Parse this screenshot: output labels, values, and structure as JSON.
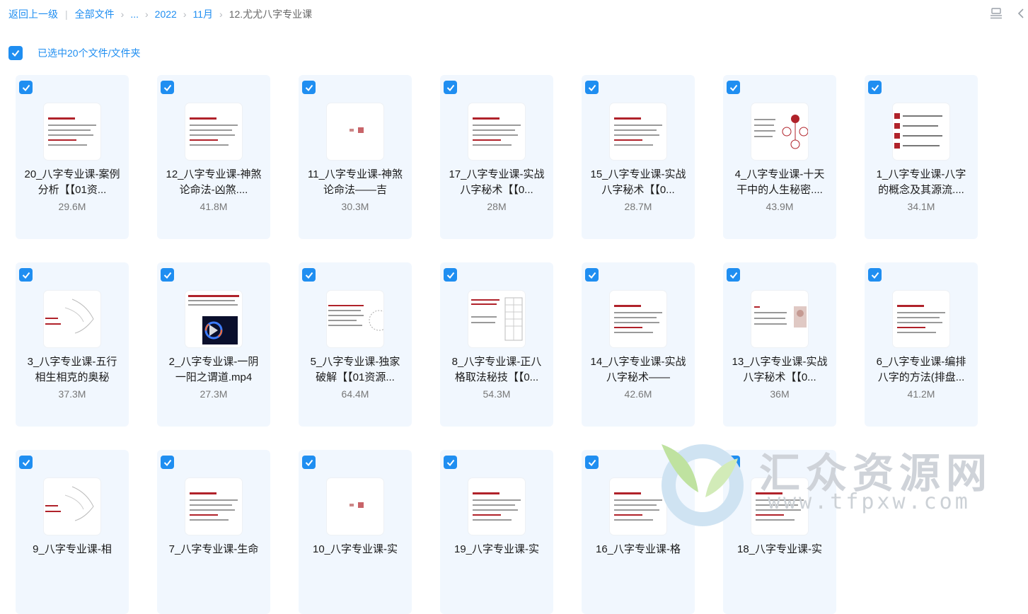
{
  "breadcrumb": {
    "back": "返回上一级",
    "all": "全部文件",
    "ellipsis": "...",
    "year": "2022",
    "month": "11月",
    "current": "12.尤尤八字专业课"
  },
  "selection": {
    "text": "已选中20个文件/文件夹"
  },
  "files": [
    {
      "name": "20_八字专业课-案例分析【【01资...",
      "size": "29.6M",
      "thumb": "text"
    },
    {
      "name": "12_八字专业课-神煞论命法-凶煞....",
      "size": "41.8M",
      "thumb": "text"
    },
    {
      "name": "11_八字专业课-神煞论命法——吉",
      "size": "30.3M",
      "thumb": "tiny"
    },
    {
      "name": "17_八字专业课-实战八字秘术【【0...",
      "size": "28M",
      "thumb": "text"
    },
    {
      "name": "15_八字专业课-实战八字秘术【【0...",
      "size": "28.7M",
      "thumb": "text"
    },
    {
      "name": "4_八字专业课-十天干中的人生秘密....",
      "size": "43.9M",
      "thumb": "diagram"
    },
    {
      "name": "1_八字专业课-八字的概念及其源流....",
      "size": "34.1M",
      "thumb": "list"
    },
    {
      "name": "3_八字专业课-五行相生相克的奥秘",
      "size": "37.3M",
      "thumb": "sketch"
    },
    {
      "name": "2_八字专业课-一阴一阳之谓道.mp4",
      "size": "27.3M",
      "thumb": "video"
    },
    {
      "name": "5_八字专业课-独家破解【【01资源...",
      "size": "64.4M",
      "thumb": "wheel"
    },
    {
      "name": "8_八字专业课-正八格取法秘技【【0...",
      "size": "54.3M",
      "thumb": "table"
    },
    {
      "name": "14_八字专业课-实战八字秘术——",
      "size": "42.6M",
      "thumb": "text"
    },
    {
      "name": "13_八字专业课-实战八字秘术【【0...",
      "size": "36M",
      "thumb": "photo"
    },
    {
      "name": "6_八字专业课-编排八字的方法(排盘...",
      "size": "41.2M",
      "thumb": "text"
    },
    {
      "name": "9_八字专业课-相",
      "size": "",
      "thumb": "sketch"
    },
    {
      "name": "7_八字专业课-生命",
      "size": "",
      "thumb": "text"
    },
    {
      "name": "10_八字专业课-实",
      "size": "",
      "thumb": "tiny"
    },
    {
      "name": "19_八字专业课-实",
      "size": "",
      "thumb": "text"
    },
    {
      "name": "16_八字专业课-格",
      "size": "",
      "thumb": "text"
    },
    {
      "name": "18_八字专业课-实",
      "size": "",
      "thumb": "text"
    }
  ],
  "watermark": {
    "title": "汇众资源网",
    "url": "www.tfpxw.com"
  },
  "colors": {
    "accent": "#1f8ef1",
    "card_bg": "#f1f7fe",
    "red_text": "#b0222a"
  }
}
